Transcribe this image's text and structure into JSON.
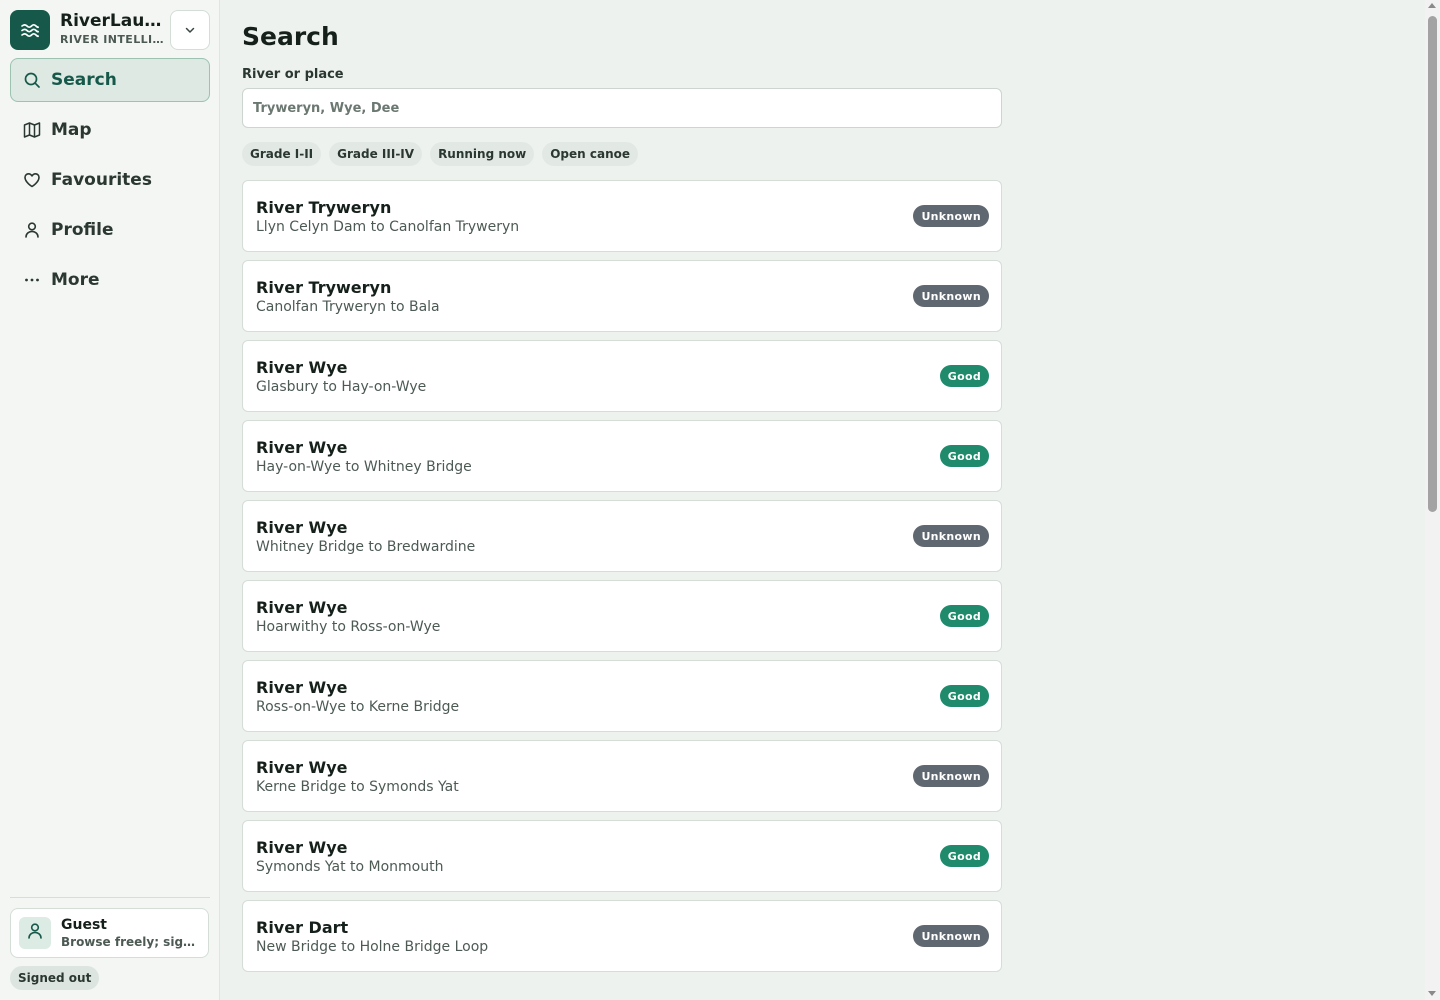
{
  "app": {
    "name": "RiverLaunch",
    "subtitle": "RIVER INTELLIGENCE",
    "logo_icon": "waves-icon",
    "toggle_icon": "chevron-down-icon"
  },
  "nav": {
    "items": [
      {
        "label": "Search",
        "icon": "search-icon",
        "active": true
      },
      {
        "label": "Map",
        "icon": "map-icon",
        "active": false
      },
      {
        "label": "Favourites",
        "icon": "heart-icon",
        "active": false
      },
      {
        "label": "Profile",
        "icon": "user-icon",
        "active": false
      },
      {
        "label": "More",
        "icon": "more-icon",
        "active": false
      }
    ]
  },
  "user": {
    "name": "Guest",
    "note": "Browse freely; sign in to save favourites",
    "status": "Signed out",
    "icon": "user-icon"
  },
  "main": {
    "title": "Search",
    "search": {
      "label": "River or place",
      "placeholder": "Tryweryn, Wye, Dee",
      "value": ""
    },
    "filters": [
      "Grade I-II",
      "Grade III-IV",
      "Running now",
      "Open canoe"
    ],
    "results": [
      {
        "river": "River Tryweryn",
        "section": "Llyn Celyn Dam to Canolfan Tryweryn",
        "status": "Unknown"
      },
      {
        "river": "River Tryweryn",
        "section": "Canolfan Tryweryn to Bala",
        "status": "Unknown"
      },
      {
        "river": "River Wye",
        "section": "Glasbury to Hay-on-Wye",
        "status": "Good"
      },
      {
        "river": "River Wye",
        "section": "Hay-on-Wye to Whitney Bridge",
        "status": "Good"
      },
      {
        "river": "River Wye",
        "section": "Whitney Bridge to Bredwardine",
        "status": "Unknown"
      },
      {
        "river": "River Wye",
        "section": "Hoarwithy to Ross-on-Wye",
        "status": "Good"
      },
      {
        "river": "River Wye",
        "section": "Ross-on-Wye to Kerne Bridge",
        "status": "Good"
      },
      {
        "river": "River Wye",
        "section": "Kerne Bridge to Symonds Yat",
        "status": "Unknown"
      },
      {
        "river": "River Wye",
        "section": "Symonds Yat to Monmouth",
        "status": "Good"
      },
      {
        "river": "River Dart",
        "section": "New Bridge to Holne Bridge Loop",
        "status": "Unknown"
      }
    ]
  },
  "colors": {
    "brand": "#16584a",
    "status_good": "#1f8a6c",
    "status_unknown": "#5f6870",
    "background": "#edf2ee"
  }
}
